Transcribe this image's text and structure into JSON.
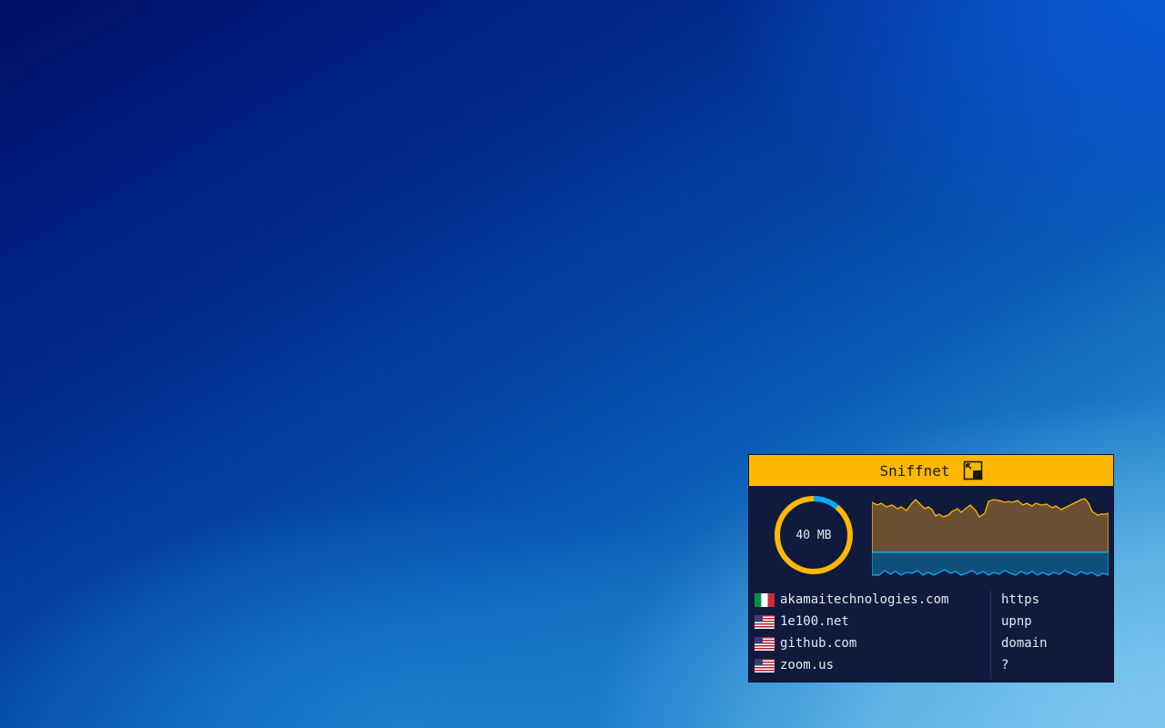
{
  "widget": {
    "title": "Sniffnet",
    "restore_icon": "restore-window-icon"
  },
  "traffic": {
    "total_label": "40 MB",
    "incoming_share": 0.89,
    "outgoing_share": 0.11,
    "colors": {
      "incoming": "#ffb800",
      "outgoing": "#0fa6f2",
      "incoming_fill": "#6b4f33",
      "outgoing_fill": "#0f4f7a",
      "accent": "#ffb800",
      "background": "#0f1a3d"
    }
  },
  "hosts": [
    {
      "flag": "it-flag-icon",
      "name": "akamaitechnologies.com"
    },
    {
      "flag": "us-flag-icon",
      "name": "1e100.net"
    },
    {
      "flag": "us-flag-icon",
      "name": "github.com"
    },
    {
      "flag": "us-flag-icon",
      "name": "zoom.us"
    }
  ],
  "services": [
    "https",
    "upnp",
    "domain",
    "?"
  ]
}
